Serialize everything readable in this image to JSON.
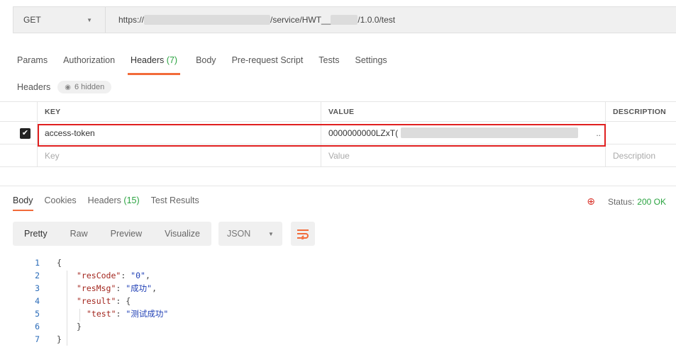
{
  "request": {
    "method": "GET",
    "url_prefix": "https://",
    "url_mid": "/service/HWT__",
    "url_suffix": "/1.0.0/test"
  },
  "tabs": [
    {
      "label": "Params"
    },
    {
      "label": "Authorization"
    },
    {
      "label": "Headers",
      "count": "(7)"
    },
    {
      "label": "Body"
    },
    {
      "label": "Pre-request Script"
    },
    {
      "label": "Tests"
    },
    {
      "label": "Settings"
    }
  ],
  "headers_section": {
    "label": "Headers",
    "hidden_badge": "6 hidden"
  },
  "headers_table": {
    "columns": {
      "key": "KEY",
      "value": "VALUE",
      "description": "DESCRIPTION"
    },
    "rows": [
      {
        "key": "access-token",
        "value": "0000000000LZxT(",
        "ellipsis": "..",
        "checked": true
      }
    ],
    "placeholders": {
      "key": "Key",
      "value": "Value",
      "description": "Description"
    }
  },
  "response_tabs": [
    {
      "label": "Body"
    },
    {
      "label": "Cookies"
    },
    {
      "label": "Headers",
      "count": "(15)"
    },
    {
      "label": "Test Results"
    }
  ],
  "status": {
    "label": "Status:",
    "value": "200 OK"
  },
  "view_modes": [
    "Pretty",
    "Raw",
    "Preview",
    "Visualize"
  ],
  "format": "JSON",
  "code_lines": [
    "1",
    "2",
    "3",
    "4",
    "5",
    "6",
    "7"
  ],
  "body": {
    "open": "{",
    "resCode_key": "\"resCode\"",
    "resCode_val": "\"0\"",
    "resMsg_key": "\"resMsg\"",
    "resMsg_val": "\"成功\"",
    "result_key": "\"result\"",
    "test_key": "\"test\"",
    "test_val": "\"测试成功\"",
    "inner_close": "}",
    "close": "}"
  },
  "colors": {
    "accent": "#f26b3a",
    "success": "#2ba441",
    "highlight_border": "#e02020"
  }
}
